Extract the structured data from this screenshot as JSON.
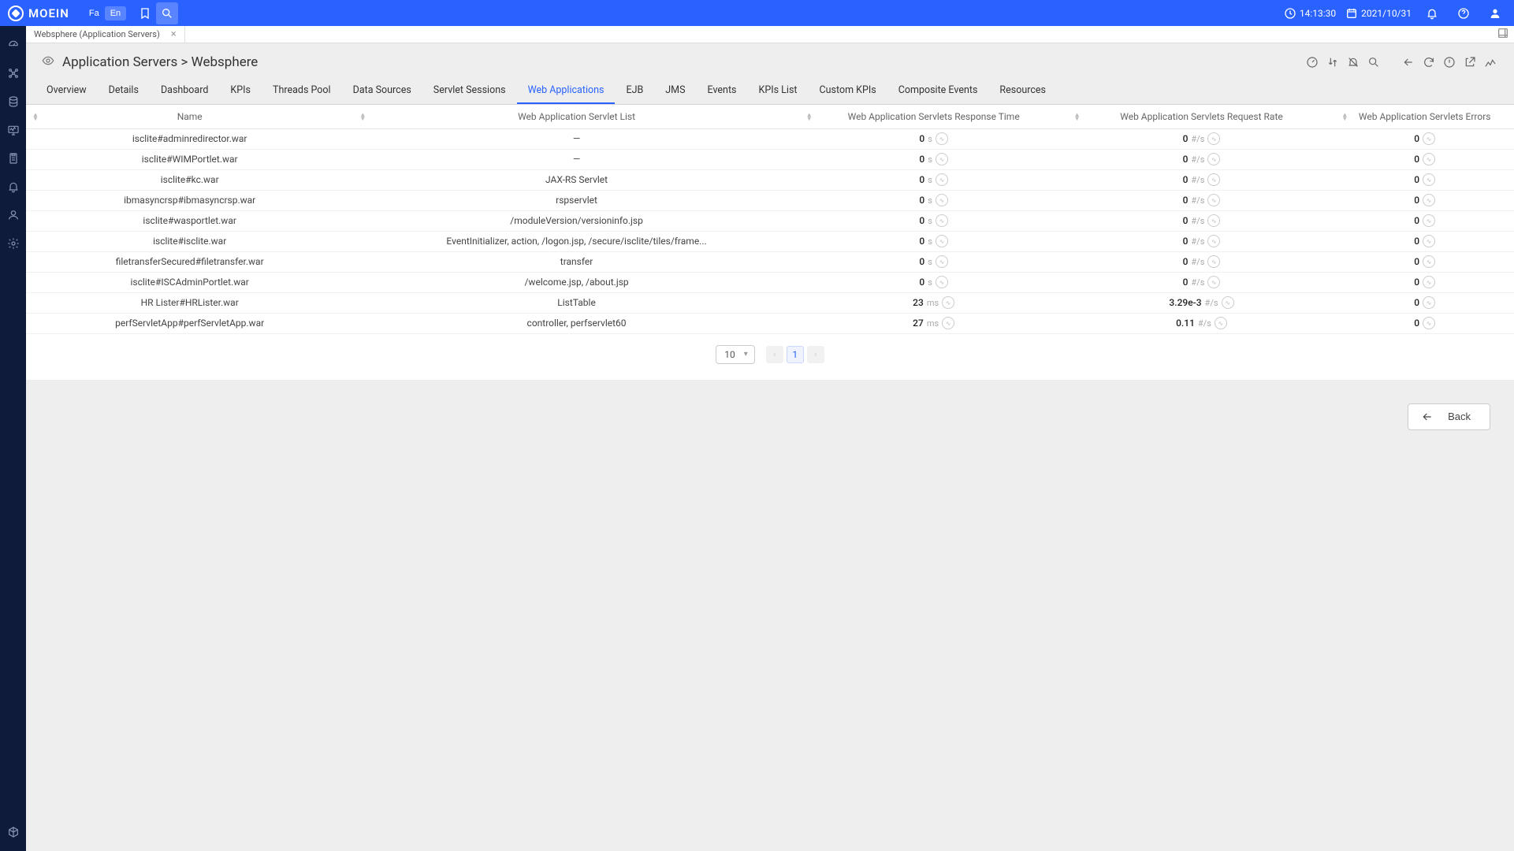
{
  "brand": "MOEIN",
  "lang": {
    "fa": "Fa",
    "en": "En"
  },
  "clock": {
    "time": "14:13:30",
    "date": "2021/10/31"
  },
  "doc_tab": {
    "label": "Websphere (Application Servers)"
  },
  "breadcrumb": {
    "parent": "Application Servers",
    "sep": ">",
    "current": "Websphere"
  },
  "sub_tabs": [
    "Overview",
    "Details",
    "Dashboard",
    "KPIs",
    "Threads Pool",
    "Data Sources",
    "Servlet Sessions",
    "Web Applications",
    "EJB",
    "JMS",
    "Events",
    "KPIs List",
    "Custom KPIs",
    "Composite Events",
    "Resources"
  ],
  "active_sub_tab": "Web Applications",
  "columns": [
    "Name",
    "Web Application Servlet List",
    "Web Application Servlets Response Time",
    "Web Application Servlets Request Rate",
    "Web Application Servlets Errors"
  ],
  "rows": [
    {
      "name": "isclite#adminredirector.war",
      "list": "—",
      "rt_val": "0",
      "rt_unit": "s",
      "rr_val": "0",
      "rr_unit": "#/s",
      "err_val": "0"
    },
    {
      "name": "isclite#WIMPortlet.war",
      "list": "—",
      "rt_val": "0",
      "rt_unit": "s",
      "rr_val": "0",
      "rr_unit": "#/s",
      "err_val": "0"
    },
    {
      "name": "isclite#kc.war",
      "list": "JAX-RS Servlet",
      "rt_val": "0",
      "rt_unit": "s",
      "rr_val": "0",
      "rr_unit": "#/s",
      "err_val": "0"
    },
    {
      "name": "ibmasyncrsp#ibmasyncrsp.war",
      "list": "rspservlet",
      "rt_val": "0",
      "rt_unit": "s",
      "rr_val": "0",
      "rr_unit": "#/s",
      "err_val": "0"
    },
    {
      "name": "isclite#wasportlet.war",
      "list": "/moduleVersion/versioninfo.jsp",
      "rt_val": "0",
      "rt_unit": "s",
      "rr_val": "0",
      "rr_unit": "#/s",
      "err_val": "0"
    },
    {
      "name": "isclite#isclite.war",
      "list": "EventInitializer, action, /logon.jsp, /secure/isclite/tiles/frame...",
      "rt_val": "0",
      "rt_unit": "s",
      "rr_val": "0",
      "rr_unit": "#/s",
      "err_val": "0"
    },
    {
      "name": "filetransferSecured#filetransfer.war",
      "list": "transfer",
      "rt_val": "0",
      "rt_unit": "s",
      "rr_val": "0",
      "rr_unit": "#/s",
      "err_val": "0"
    },
    {
      "name": "isclite#ISCAdminPortlet.war",
      "list": "/welcome.jsp, /about.jsp",
      "rt_val": "0",
      "rt_unit": "s",
      "rr_val": "0",
      "rr_unit": "#/s",
      "err_val": "0"
    },
    {
      "name": "HR Lister#HRLister.war",
      "list": "ListTable",
      "rt_val": "23",
      "rt_unit": "ms",
      "rr_val": "3.29e-3",
      "rr_unit": "#/s",
      "err_val": "0"
    },
    {
      "name": "perfServletApp#perfServletApp.war",
      "list": "controller, perfservlet60",
      "rt_val": "27",
      "rt_unit": "ms",
      "rr_val": "0.11",
      "rr_unit": "#/s",
      "err_val": "0"
    }
  ],
  "page_size": "10",
  "current_page": "1",
  "back_label": "Back"
}
